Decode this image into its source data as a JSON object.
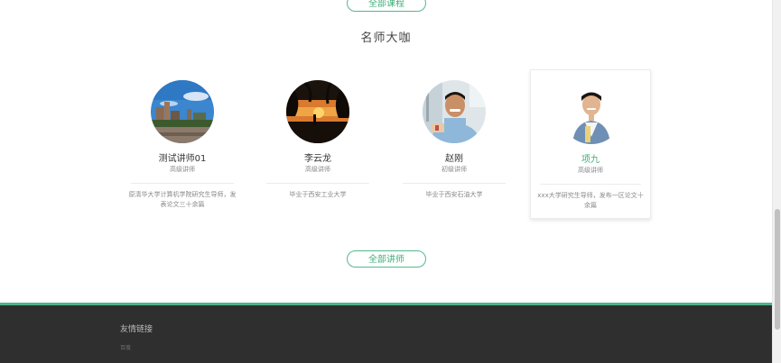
{
  "top_button": {
    "label": "全部课程"
  },
  "section": {
    "title": "名师大咖"
  },
  "teachers": [
    {
      "name": "测试讲师01",
      "level": "高级讲师",
      "description": "原清华大学计算机学院研究生导师，发表论文三十余篇",
      "avatar_icon": "city-photo"
    },
    {
      "name": "李云龙",
      "level": "高级讲师",
      "description": "毕业于西安工业大学",
      "avatar_icon": "sunset-photo"
    },
    {
      "name": "赵刚",
      "level": "初级讲师",
      "description": "毕业于西安石油大学",
      "avatar_icon": "man-photo"
    },
    {
      "name": "项九",
      "level": "高级讲师",
      "description": "xxx大学研究生导师，发布一区论文十余篇",
      "avatar_icon": "man-photo"
    }
  ],
  "all_teachers_button": {
    "label": "全部讲师"
  },
  "footer": {
    "title": "友情链接",
    "links": [
      "百度"
    ]
  },
  "colors": {
    "accent": "#3fae78",
    "footer_bg": "#2f2f2f"
  }
}
